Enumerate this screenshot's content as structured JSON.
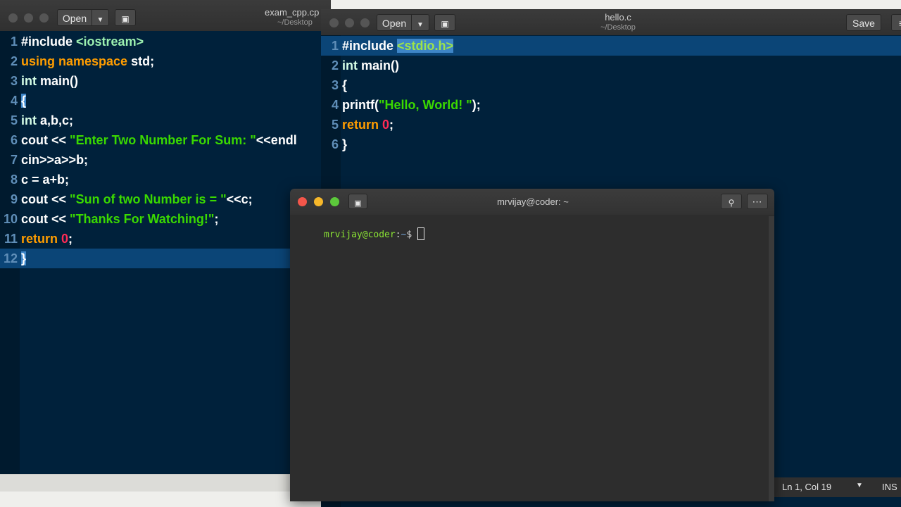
{
  "left_editor": {
    "title": "exam_cpp.cpp",
    "title_visible": "exam_cpp.cp",
    "subtitle": "~/Desktop",
    "open_label": "Open",
    "lines": [
      {
        "n": "1"
      },
      {
        "n": "2"
      },
      {
        "n": "3"
      },
      {
        "n": "4"
      },
      {
        "n": "5"
      },
      {
        "n": "6"
      },
      {
        "n": "7"
      },
      {
        "n": "8"
      },
      {
        "n": "9"
      },
      {
        "n": "10"
      },
      {
        "n": "11"
      },
      {
        "n": "12"
      }
    ],
    "code": {
      "l1a": "#include ",
      "l1b": "<iostream>",
      "l2a": "using namespace ",
      "l2b": "std;",
      "l3a": "int",
      "l3b": " main()",
      "l4a": "{",
      "l5a": "int",
      "l5b": " a,b,c;",
      "l6a": "cout << ",
      "l6b": "\"Enter Two Number For Sum: \"",
      "l6c": "<<endl",
      "l7a": "cin>>a>>b;",
      "l8a": "c = a+b;",
      "l9a": "cout << ",
      "l9b": "\"Sun of two Number is = \"",
      "l9c": "<<c;",
      "l10a": "cout << ",
      "l10b": "\"Thanks For Watching!\"",
      "l10c": ";",
      "l11a": "return ",
      "l11b": "0",
      "l11c": ";",
      "l12a": "}"
    }
  },
  "right_editor": {
    "title": "hello.c",
    "subtitle": "~/Desktop",
    "open_label": "Open",
    "save_label": "Save",
    "lines": [
      {
        "n": "1"
      },
      {
        "n": "2"
      },
      {
        "n": "3"
      },
      {
        "n": "4"
      },
      {
        "n": "5"
      },
      {
        "n": "6"
      }
    ],
    "code": {
      "l1a": "#include ",
      "l1b": "<",
      "l1c": "stdio.h",
      "l1d": ">",
      "l2a": "int",
      "l2b": " main()",
      "l3a": "{",
      "l4a": "printf(",
      "l4b": "\"Hello, World! \"",
      "l4c": ");",
      "l5a": "return ",
      "l5b": "0",
      "l5c": ";",
      "l6a": "}"
    },
    "status": {
      "position": "Ln 1, Col 19",
      "mode": "INS"
    }
  },
  "terminal": {
    "title": "mrvijay@coder: ~",
    "prompt_user": "mrvijay@coder",
    "prompt_sep": ":",
    "prompt_path": "~",
    "prompt_symbol": "$ "
  },
  "colors": {
    "editor_bg": "#00213b",
    "current_line": "#0b4577",
    "keyword": "#ff9d00",
    "string": "#3ad900",
    "number": "#ff2a55",
    "terminal_bg": "#2d2d2d",
    "prompt_green": "#8ae234"
  }
}
